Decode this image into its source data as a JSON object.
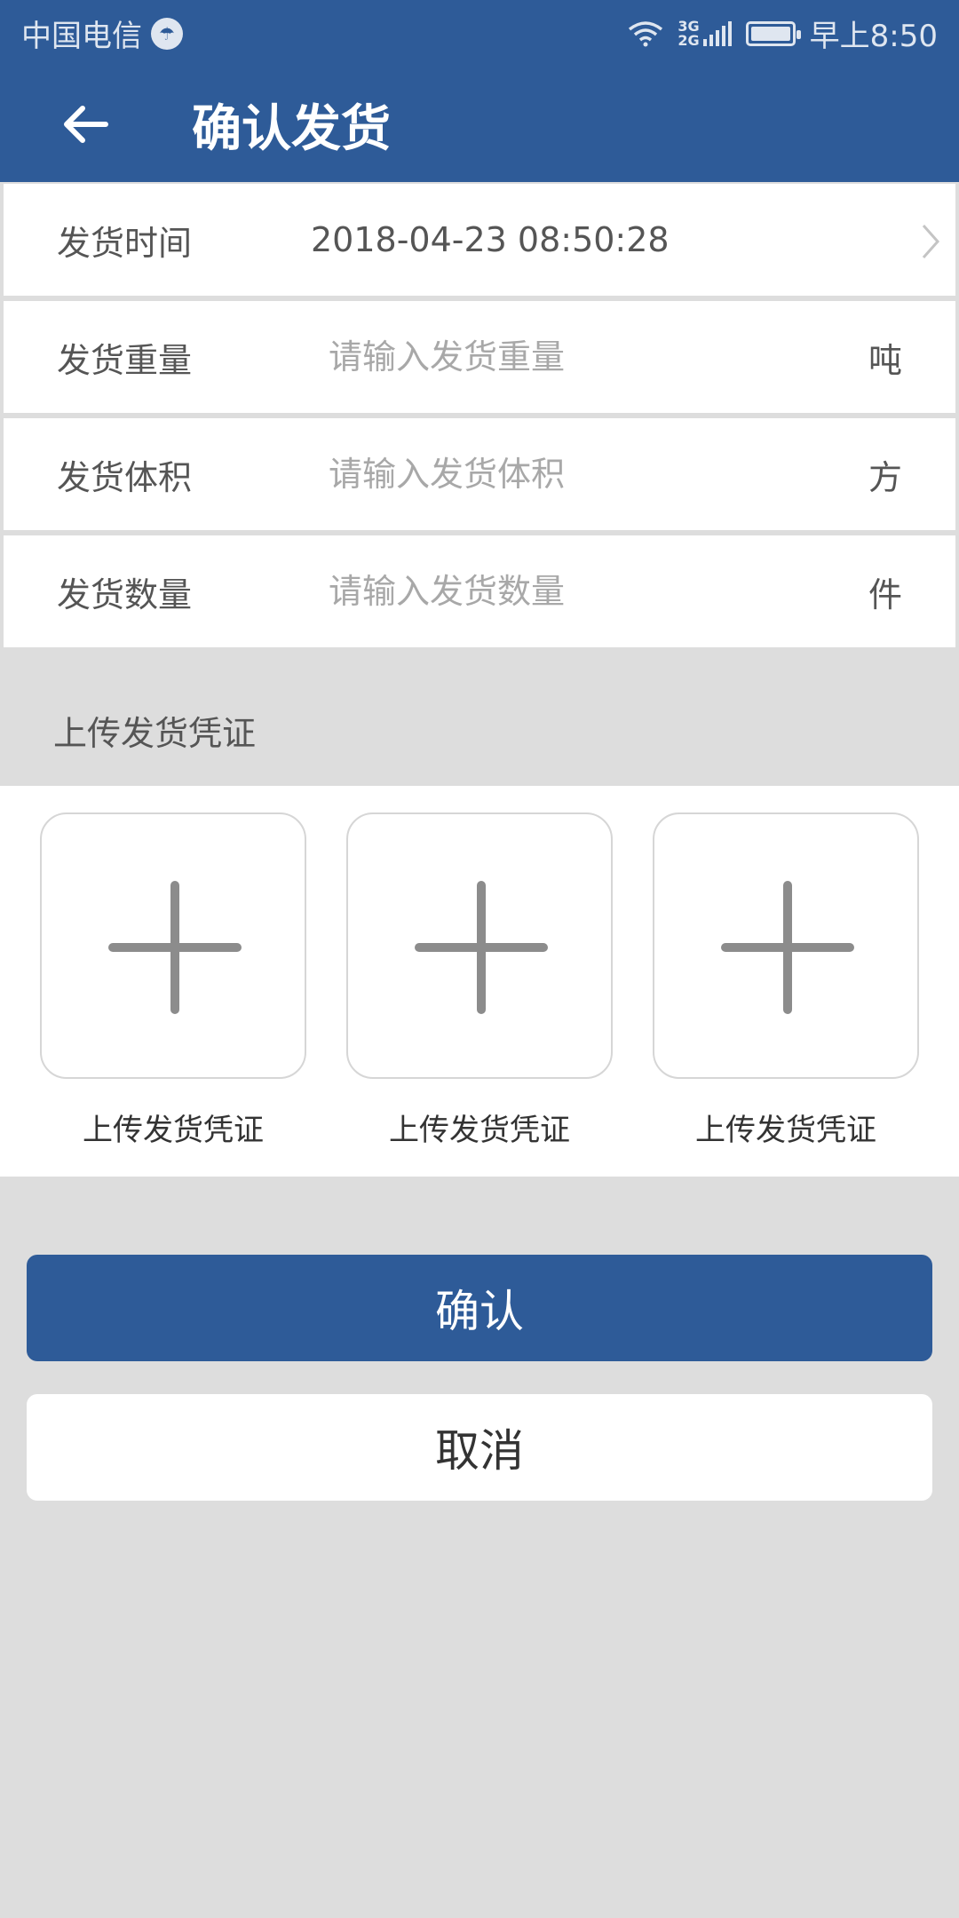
{
  "status_bar": {
    "carrier": "中国电信",
    "carrier_icon": "hd-badge",
    "network": [
      "3G",
      "2G"
    ],
    "time": "早上8:50"
  },
  "header": {
    "back_icon": "arrow-left-icon",
    "title": "确认发货"
  },
  "form": {
    "ship_time": {
      "label": "发货时间",
      "value": "2018-04-23 08:50:28"
    },
    "weight": {
      "label": "发货重量",
      "placeholder": "请输入发货重量",
      "unit": "吨"
    },
    "volume": {
      "label": "发货体积",
      "placeholder": "请输入发货体积",
      "unit": "方"
    },
    "quantity": {
      "label": "发货数量",
      "placeholder": "请输入发货数量",
      "unit": "件"
    }
  },
  "upload": {
    "section_label": "上传发货凭证",
    "tiles": [
      {
        "caption": "上传发货凭证"
      },
      {
        "caption": "上传发货凭证"
      },
      {
        "caption": "上传发货凭证"
      }
    ]
  },
  "actions": {
    "confirm_label": "确认",
    "cancel_label": "取消"
  },
  "colors": {
    "brand": "#2e5b98",
    "background": "#dddddd",
    "placeholder": "#a8a8a8"
  }
}
